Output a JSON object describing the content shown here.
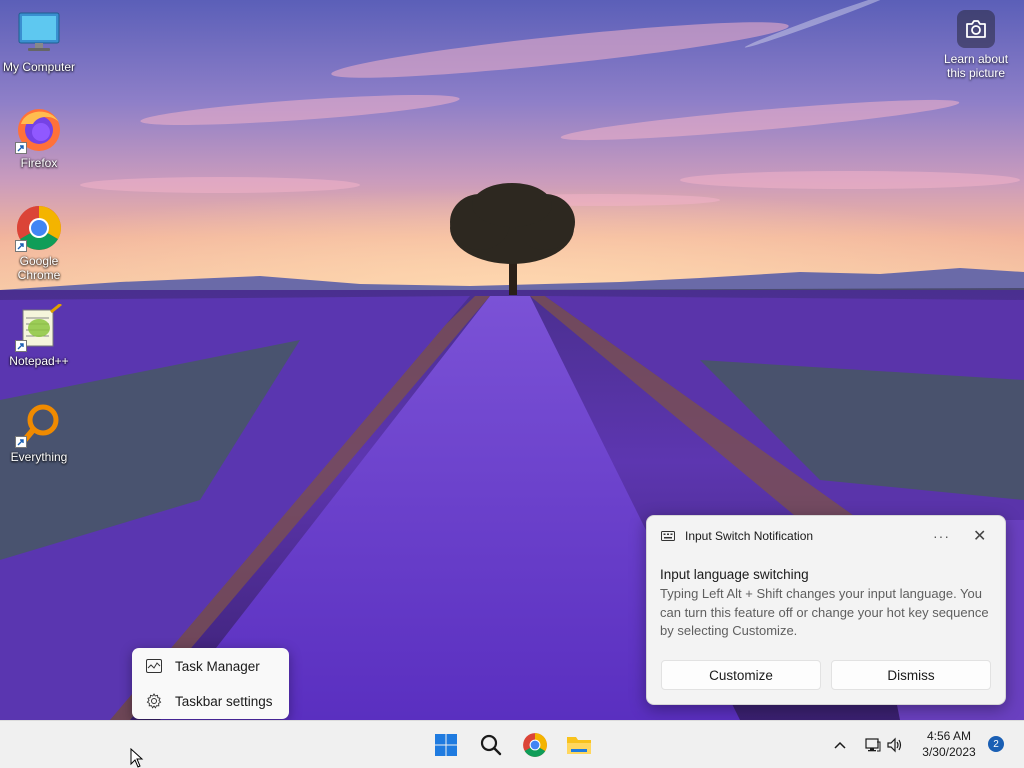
{
  "desktop": {
    "icons": [
      {
        "label": "My Computer"
      },
      {
        "label": "Firefox"
      },
      {
        "label": "Google Chrome"
      },
      {
        "label": "Notepad++"
      },
      {
        "label": "Everything"
      }
    ],
    "learn_picture": {
      "label": "Learn about this picture",
      "icon": "camera-icon"
    }
  },
  "notification": {
    "app": "Input Switch Notification",
    "more": "···",
    "close": "✕",
    "title": "Input language switching",
    "body": "Typing Left Alt + Shift changes your input language. You can turn this feature off or change your hot key sequence by selecting Customize.",
    "buttons": {
      "customize": "Customize",
      "dismiss": "Dismiss"
    }
  },
  "context_menu": {
    "items": [
      {
        "label": "Task Manager",
        "icon": "task-manager-icon"
      },
      {
        "label": "Taskbar settings",
        "icon": "gear-icon"
      }
    ]
  },
  "taskbar": {
    "apps": [
      "start-icon",
      "search-icon",
      "chrome-icon",
      "file-explorer-icon"
    ],
    "tray": {
      "chevron": "^",
      "time": "4:56 AM",
      "date": "3/30/2023",
      "notification_count": "2"
    }
  },
  "colors": {
    "taskbar_bg": "#f0f0f0",
    "toast_bg": "#f3f3f3",
    "accent": "#1a5fb4",
    "lavender": "#6a3fc4"
  }
}
